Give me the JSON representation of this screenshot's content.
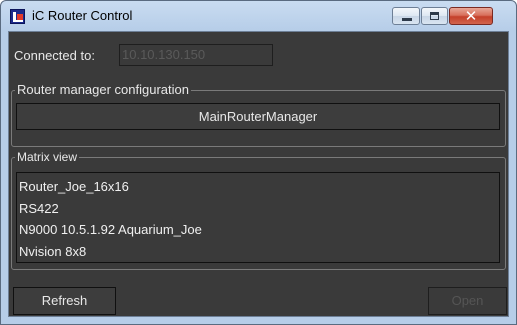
{
  "window": {
    "title": "iC Router Control",
    "close_glyph": "✕",
    "icons": [
      "app-icon",
      "minimize-icon",
      "maximize-icon",
      "close-icon"
    ]
  },
  "connection": {
    "label": "Connected to:",
    "value": "10.10.130.150"
  },
  "router_config": {
    "group_title": "Router manager configuration",
    "manager_button_label": "MainRouterManager"
  },
  "matrix_view": {
    "group_title": "Matrix view",
    "items": [
      "Router_Joe_16x16",
      "RS422",
      "N9000 10.5.1.92 Aquarium_Joe",
      "Nvision 8x8"
    ]
  },
  "actions": {
    "refresh_label": "Refresh",
    "open_label": "Open"
  },
  "colors": {
    "client_background": "#3a3a3a",
    "text": "#e8e8e8",
    "disabled_text": "#555555",
    "titlebar": "#b6cde8",
    "close_button": "#c4402a"
  }
}
